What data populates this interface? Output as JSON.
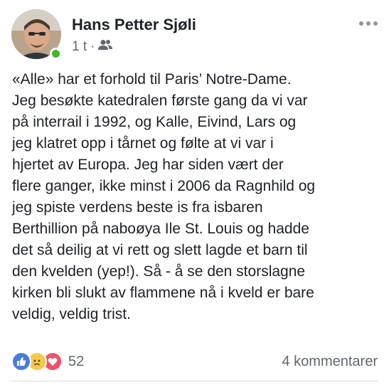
{
  "post": {
    "author": "Hans Petter Sjøli",
    "time": "1 t",
    "separator": "·",
    "audience_icon": "friends-icon",
    "more_icon": "more-dots-icon",
    "text": "«Alle» har et forhold til Paris’ Notre-Dame.\nJeg besøkte katedralen første gang da vi var\npå interrail i 1992, og Kalle, Eivind, Lars og\njeg klatret opp i tårnet og følte at vi var i\nhjertet av Europa. Jeg har siden vært der\nflere ganger, ikke minst i 2006 da Ragnhild og\njeg spiste verdens beste is fra isbaren\nBerthillion på naboøya Ile St. Louis og hadde\ndet så deilig at vi rett og slett lagde et barn til\nden kvelden (yep!). Så - å se den storslagne\nkirken bli slukt av flammene nå i kveld er bare\nveldig, veldig trist."
  },
  "footer": {
    "reactions": [
      "like-icon",
      "sad-icon",
      "love-icon"
    ],
    "reaction_count": "52",
    "comments": "4 kommentarer"
  },
  "colors": {
    "online": "#42b72a",
    "like": "#4a7ddb",
    "sad": "#f7c84b",
    "love": "#f25268",
    "secondary_text": "#606770"
  }
}
